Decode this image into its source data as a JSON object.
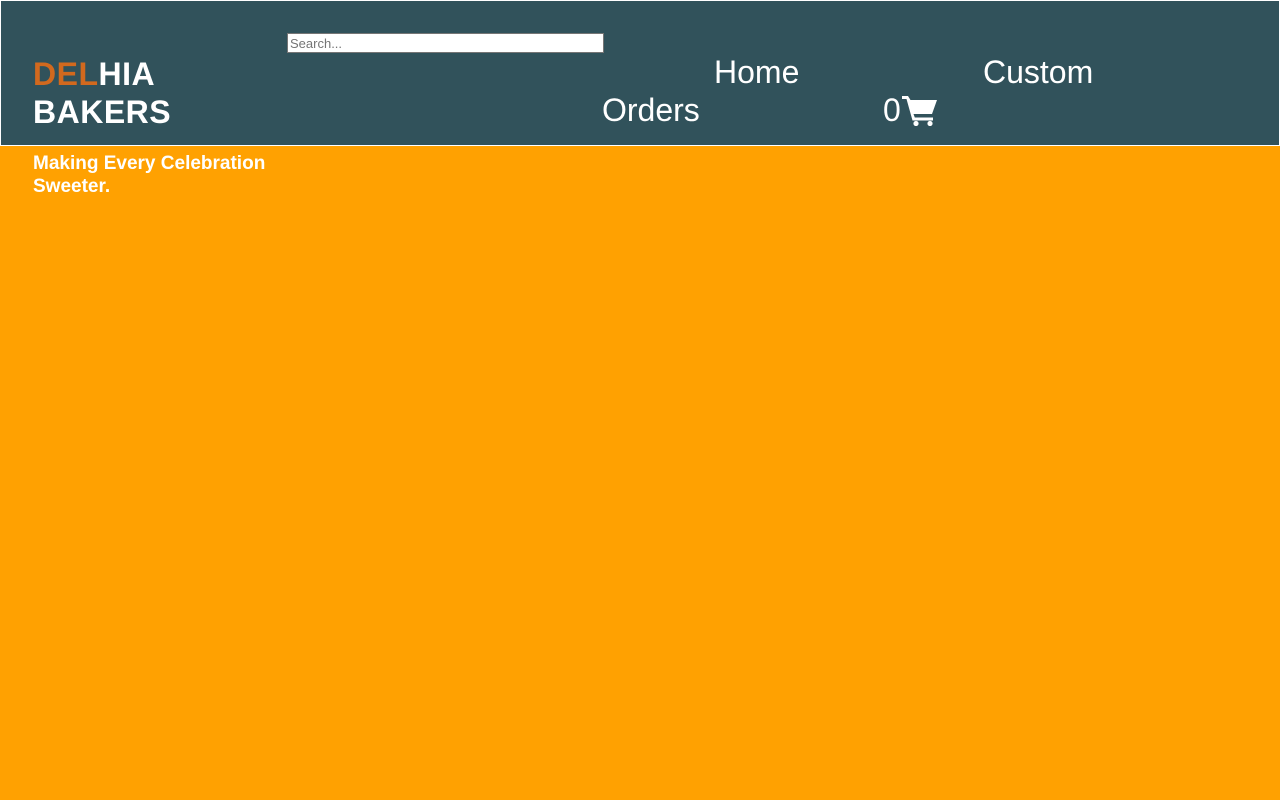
{
  "header": {
    "brand": {
      "part1": "DEL",
      "part2": "HIA",
      "line2": "BAKERS"
    },
    "search": {
      "placeholder": "Search...",
      "value": ""
    },
    "nav": {
      "home": "Home",
      "custom": "Custom",
      "orders": "Orders"
    },
    "cart": {
      "count": "0",
      "icon": "cart-icon"
    }
  },
  "hero": {
    "tagline": "Making Every Celebration Sweeter."
  },
  "colors": {
    "header_bg": "#31525b",
    "body_bg": "#ffa101",
    "brand_accent": "#d2691e",
    "text": "#ffffff"
  }
}
